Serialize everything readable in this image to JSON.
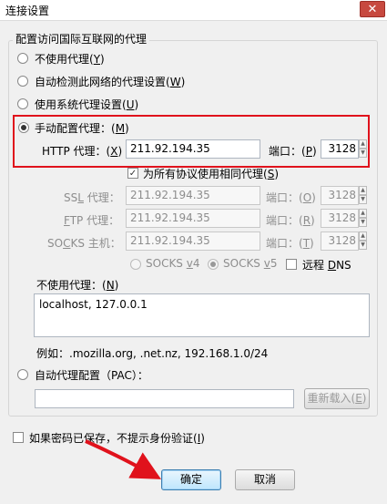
{
  "window": {
    "title": "连接设置",
    "close_glyph": "✕"
  },
  "group": {
    "label": "配置访问国际互联网的代理"
  },
  "options": {
    "no_proxy": {
      "text": "不使用代理(",
      "key": "Y",
      "tail": ")"
    },
    "auto_detect": {
      "text": "自动检测此网络的代理设置(",
      "key": "W",
      "tail": ")"
    },
    "system": {
      "text": "使用系统代理设置(",
      "key": "U",
      "tail": ")"
    },
    "manual": {
      "text": "手动配置代理：(",
      "key": "M",
      "tail": ")"
    },
    "auto_config": {
      "text": "自动代理配置（PAC）："
    }
  },
  "http": {
    "label": "HTTP 代理：(",
    "key": "X",
    "tail": ")",
    "value": "211.92.194.35",
    "port_label": "端口：(",
    "port_key": "P",
    "port_tail": ")",
    "port": "3128"
  },
  "same_proxy": {
    "text": "为所有协议使用相同代理(",
    "key": "S",
    "tail": ")",
    "check": "✓"
  },
  "ssl": {
    "label_pre": "SS",
    "key": "L",
    "label_post": " 代理：",
    "value": "211.92.194.35",
    "port_label": "端口：(",
    "port_key": "O",
    "port_tail": ")",
    "port": "3128"
  },
  "ftp": {
    "key": "F",
    "label_post": "TP 代理：",
    "value": "211.92.194.35",
    "port_label": "端口：(",
    "port_key": "R",
    "port_tail": ")",
    "port": "3128"
  },
  "socks": {
    "label_pre": "SO",
    "key": "C",
    "label_post": "KS 主机：",
    "value": "211.92.194.35",
    "port_label": "端口：(",
    "port_key": "T",
    "port_tail": ")",
    "port": "3128"
  },
  "socks_version": {
    "v4_pre": "SOCKS ",
    "v4_key": "v",
    "v4_post": "4",
    "v5_pre": "SOCKS ",
    "v5_key": "v",
    "v5_post": "5",
    "remote_dns_pre": "远程 ",
    "remote_dns_key": "D",
    "remote_dns_post": "NS"
  },
  "no_proxy_for": {
    "label": "不使用代理：(",
    "key": "N",
    "tail": ")",
    "value": "localhost, 127.0.0.1"
  },
  "example": "例如：.mozilla.org, .net.nz, 192.168.1.0/24",
  "reload_button": {
    "text": "重新载入(",
    "key": "E",
    "tail": ")"
  },
  "save_password": {
    "text": "如果密码已保存，不提示身份验证(",
    "key": "I",
    "tail": ")"
  },
  "buttons": {
    "ok": "确定",
    "cancel": "取消"
  },
  "colors": {
    "highlight": "#e0121c",
    "arrow": "#e0121c"
  }
}
